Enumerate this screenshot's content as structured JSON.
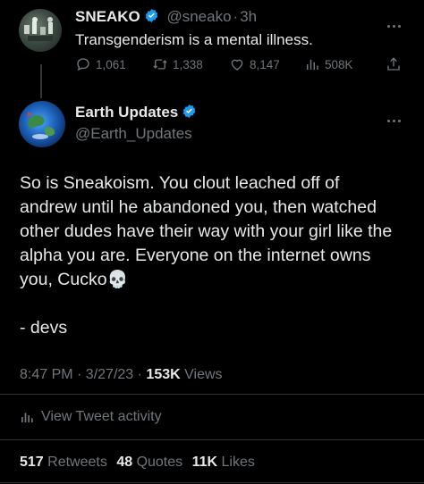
{
  "parent_tweet": {
    "display_name": "SNEAKO",
    "handle": "@sneako",
    "separator": "·",
    "time_ago": "3h",
    "text": "Transgenderism is a mental illness.",
    "replies": "1,061",
    "retweets": "1,338",
    "likes": "8,147",
    "views": "508K"
  },
  "main_tweet": {
    "display_name": "Earth Updates",
    "handle": "@Earth_Updates",
    "body_lines": [
      "So is Sneakoism. You clout leached off of",
      "andrew until he abandoned you, then watched",
      "other dudes have their way with your girl like the",
      "alpha you are. Everyone on the internet owns",
      "you, Cucko"
    ],
    "emoji": "💀",
    "signature": "- devs",
    "timestamp": "8:47 PM · 3/27/23 ·",
    "view_count": "153K",
    "views_label": "Views",
    "activity_label": "View Tweet activity",
    "retweets_count": "517",
    "retweets_label": "Retweets",
    "quotes_count": "48",
    "quotes_label": "Quotes",
    "likes_count": "11K",
    "likes_label": "Likes"
  },
  "colors": {
    "background": "#000000",
    "text": "#e7e9ea",
    "muted": "#71767b",
    "verified": "#1d9bf0",
    "divider": "#2f3336"
  },
  "icons": [
    "verified-badge-icon",
    "more-icon",
    "reply-icon",
    "retweet-icon",
    "like-icon",
    "views-icon",
    "share-icon",
    "activity-icon",
    "skull-emoji-icon"
  ]
}
